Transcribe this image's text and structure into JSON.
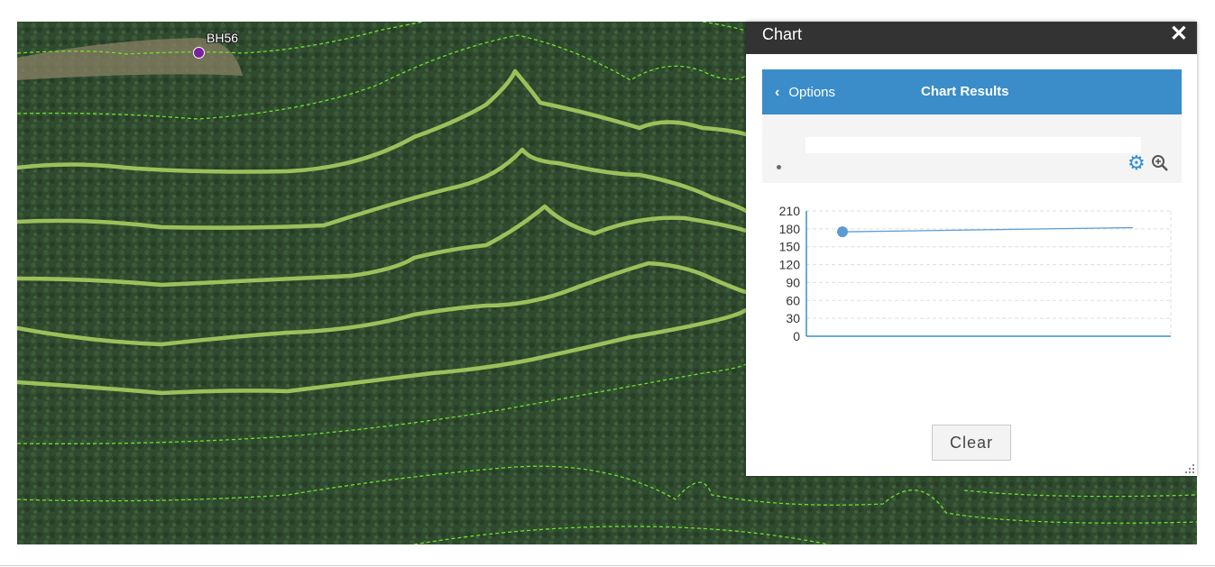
{
  "map": {
    "borehole_label": "BH56"
  },
  "panel": {
    "title": "Chart",
    "close_symbol": "✕",
    "options_label": "Options",
    "results_title": "Chart Results",
    "clear_label": "Clear"
  },
  "icons": {
    "back": "chevron-left-icon",
    "settings": "gear-icon",
    "zoom": "zoom-in-icon",
    "close": "close-icon",
    "resize": "resize-grip-icon"
  },
  "colors": {
    "header_bg": "#333333",
    "accent": "#3a8dc8",
    "series": "#5b9bd5",
    "contour_major": "#9cc05a",
    "contour_minor": "#6ee02a"
  },
  "chart_data": {
    "type": "line",
    "y_ticks": [
      "210",
      "180",
      "150",
      "120",
      "90",
      "60",
      "30",
      "0"
    ],
    "ylim": [
      0,
      210
    ],
    "grid": true,
    "series": [
      {
        "x": [
          0,
          1
        ],
        "values": [
          175,
          182
        ]
      }
    ]
  }
}
